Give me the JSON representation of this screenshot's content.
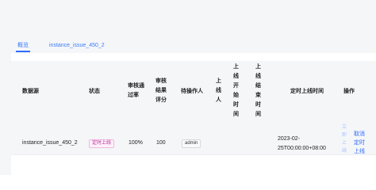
{
  "tabs": [
    {
      "label": "概览"
    },
    {
      "label": "instance_issue_450_2"
    }
  ],
  "table": {
    "headers": [
      "数据源",
      "状态",
      "审核通\n过率",
      "审核\n结果\n评分",
      "待操作人",
      "上\n线\n人",
      "上\n线\n开\n始\n时\n间",
      "上\n线\n结\n束\n时\n间",
      "定时上线时间",
      "操作"
    ],
    "row": {
      "datasource": "instance_issue_450_2",
      "status": "定时上线",
      "pass_rate": "100%",
      "score": "100",
      "pending_operator": "admin",
      "online_user": "",
      "start_time": "",
      "end_time": "",
      "scheduled_time": "2023-02-\n25T00:00:00+08:00",
      "actions": {
        "online_now": "立\n即\n上\n线",
        "cancel_schedule": "取消\n定时\n上线"
      }
    }
  }
}
